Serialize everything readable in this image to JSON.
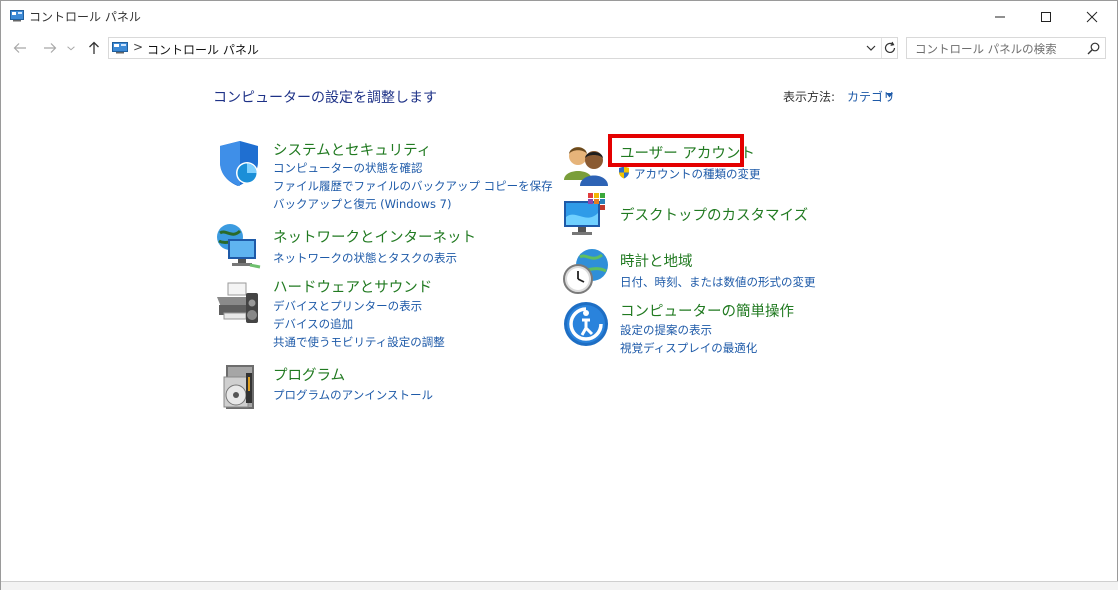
{
  "window": {
    "title": "コントロール パネル"
  },
  "address": {
    "separator": ">",
    "path": "コントロール パネル"
  },
  "search": {
    "placeholder": "コントロール パネルの検索"
  },
  "main": {
    "title": "コンピューターの設定を調整します",
    "view_by_label": "表示方法:",
    "view_by_value": "カテゴリ"
  },
  "categories_left": [
    {
      "title": "システムとセキュリティ",
      "icon": "shield-icon",
      "links": [
        "コンピューターの状態を確認",
        "ファイル履歴でファイルのバックアップ コピーを保存",
        "バックアップと復元 (Windows 7)"
      ]
    },
    {
      "title": "ネットワークとインターネット",
      "icon": "network-icon",
      "links": [
        "ネットワークの状態とタスクの表示"
      ]
    },
    {
      "title": "ハードウェアとサウンド",
      "icon": "printer-icon",
      "links": [
        "デバイスとプリンターの表示",
        "デバイスの追加",
        "共通で使うモビリティ設定の調整"
      ]
    },
    {
      "title": "プログラム",
      "icon": "programs-icon",
      "links": [
        "プログラムのアンインストール"
      ]
    }
  ],
  "categories_right": [
    {
      "title": "ユーザー アカウント",
      "icon": "users-icon",
      "links": [
        "アカウントの種類の変更"
      ]
    },
    {
      "title": "デスクトップのカスタマイズ",
      "icon": "desktop-icon",
      "links": []
    },
    {
      "title": "時計と地域",
      "icon": "clock-icon",
      "links": [
        "日付、時刻、または数値の形式の変更"
      ]
    },
    {
      "title": "コンピューターの簡単操作",
      "icon": "ease-of-access-icon",
      "links": [
        "設定の提案の表示",
        "視覚ディスプレイの最適化"
      ]
    }
  ],
  "colors": {
    "category_title": "#217a21",
    "link": "#1e5aa8",
    "page_title": "#1e3287",
    "highlight": "#e40000"
  }
}
